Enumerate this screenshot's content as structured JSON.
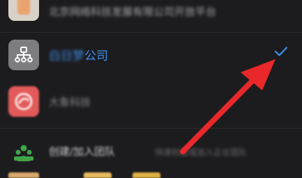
{
  "list": {
    "top_item": {
      "label": "北京网络科技发展有限公司开放平台",
      "icon": "org-app-icon"
    },
    "company_item": {
      "label_blurred": "白日梦",
      "label_visible": "公司",
      "icon": "org-chart-icon",
      "selected": true
    },
    "blurred_item": {
      "label": "大象科技",
      "icon": "app-logo-icon"
    },
    "create_item": {
      "label_visible": "创建/加入团队",
      "label_blurred": "",
      "desc": "快速创建或加入企业团队",
      "icon": "team-icon"
    }
  },
  "colors": {
    "background": "#1c1c1e",
    "accent": "#3d8ff0",
    "arrow": "#e8282a"
  }
}
